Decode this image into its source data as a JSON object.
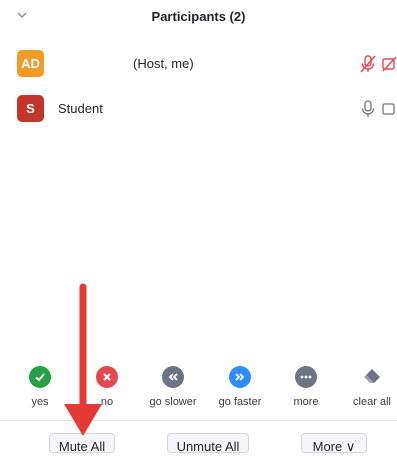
{
  "header": {
    "title": "Participants (2)",
    "collapse_icon": "chevron-down-icon"
  },
  "participants": [
    {
      "initials": "AD",
      "name": "",
      "role": "(Host, me)",
      "avatar_color": "#f29b28",
      "mic": "muted",
      "video": "off"
    },
    {
      "initials": "S",
      "name": "Student",
      "role": "",
      "avatar_color": "#c2352b",
      "mic": "on",
      "video": "off"
    }
  ],
  "feedback": [
    {
      "label": "yes",
      "icon": "check-icon",
      "color": "#24a046"
    },
    {
      "label": "no",
      "icon": "x-icon",
      "color": "#e5484d"
    },
    {
      "label": "go slower",
      "icon": "rewind-icon",
      "color": "#6e7386"
    },
    {
      "label": "go faster",
      "icon": "fast-forward-icon",
      "color": "#2d8cff"
    },
    {
      "label": "more",
      "icon": "ellipsis-icon",
      "color": "#6e7386"
    },
    {
      "label": "clear all",
      "icon": "eraser-icon",
      "color": "#6e7386"
    }
  ],
  "actions": {
    "mute_all": "Mute All",
    "unmute_all": "Unmute All",
    "more": "More ∨"
  },
  "annotation": {
    "color": "#e53935"
  }
}
